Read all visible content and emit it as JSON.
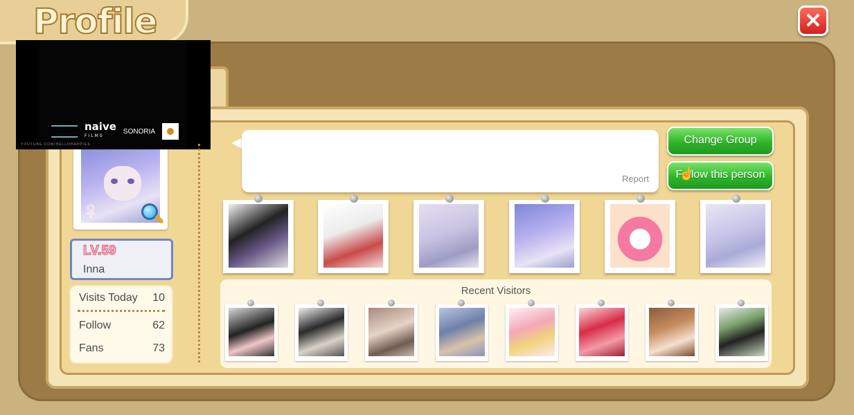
{
  "header": {
    "title": "Profile",
    "close_icon": "close-icon"
  },
  "video_overlay": {
    "logos": [
      "naive",
      "FILMS",
      "SONORIA"
    ],
    "url_text": "YOUTUBE.COM/HELLOHAPPIES"
  },
  "profile": {
    "gender_icon": "female-icon",
    "zoom_icon": "magnifier-icon",
    "level": "LV.59",
    "name": "Inna",
    "stats": [
      {
        "label": "Visits Today",
        "value": "10"
      },
      {
        "label": "Follow",
        "value": "62"
      },
      {
        "label": "Fans",
        "value": "73"
      }
    ]
  },
  "message_bubble": {
    "report_label": "Report"
  },
  "actions": {
    "change_group": "Change Group",
    "follow": "Follow this person"
  },
  "photo_wall": {
    "photos": [
      "photo-1",
      "photo-2",
      "photo-3",
      "photo-4",
      "photo-5",
      "photo-6"
    ]
  },
  "recent_visitors": {
    "title": "Recent Visitors",
    "count": 8
  },
  "colors": {
    "board": "#9c7b47",
    "card": "#f1d796",
    "green_button": "#2fb52a",
    "close_button": "#d2221d",
    "level_border": "#6f86c9"
  }
}
